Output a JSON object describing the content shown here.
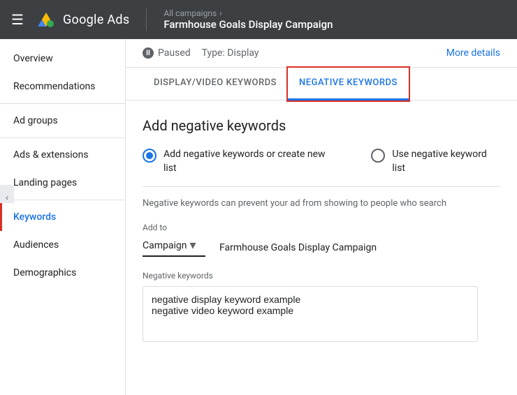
{
  "header": {
    "menu_icon": "☰",
    "logo_text": "Google Ads",
    "breadcrumb_link": "All campaigns",
    "breadcrumb_chevron": "›",
    "campaign_title": "Farmhouse Goals Display Campaign"
  },
  "campaign_status": {
    "status": "Paused",
    "type_prefix": "Type:",
    "type": "Display",
    "more_details": "More details"
  },
  "tabs": [
    {
      "id": "display-video",
      "label": "DISPLAY/VIDEO KEYWORDS",
      "active": false
    },
    {
      "id": "negative",
      "label": "NEGATIVE KEYWORDS",
      "active": true
    }
  ],
  "content": {
    "section_title": "Add negative keywords",
    "radio_option_1": "Add negative keywords or create new list",
    "radio_option_2": "Use negative keyword list",
    "info_text": "Negative keywords can prevent your ad from showing to people who search",
    "add_to_label": "Add to",
    "campaign_dropdown_label": "Campaign",
    "campaign_name": "Farmhouse Goals Display Campaign",
    "neg_keywords_label": "Negative keywords",
    "neg_keywords_value": "negative display keyword example\nnegative video keyword example"
  },
  "sidebar": {
    "items": [
      {
        "id": "overview",
        "label": "Overview",
        "active": false
      },
      {
        "id": "recommendations",
        "label": "Recommendations",
        "active": false
      },
      {
        "id": "ad-groups",
        "label": "Ad groups",
        "active": false
      },
      {
        "id": "ads-extensions",
        "label": "Ads & extensions",
        "active": false
      },
      {
        "id": "landing-pages",
        "label": "Landing pages",
        "active": false
      },
      {
        "id": "keywords",
        "label": "Keywords",
        "active": true
      },
      {
        "id": "audiences",
        "label": "Audiences",
        "active": false
      },
      {
        "id": "demographics",
        "label": "Demographics",
        "active": false
      }
    ]
  },
  "colors": {
    "active_blue": "#1a73e8",
    "red_border": "#d93025",
    "header_bg": "#3c4043"
  }
}
